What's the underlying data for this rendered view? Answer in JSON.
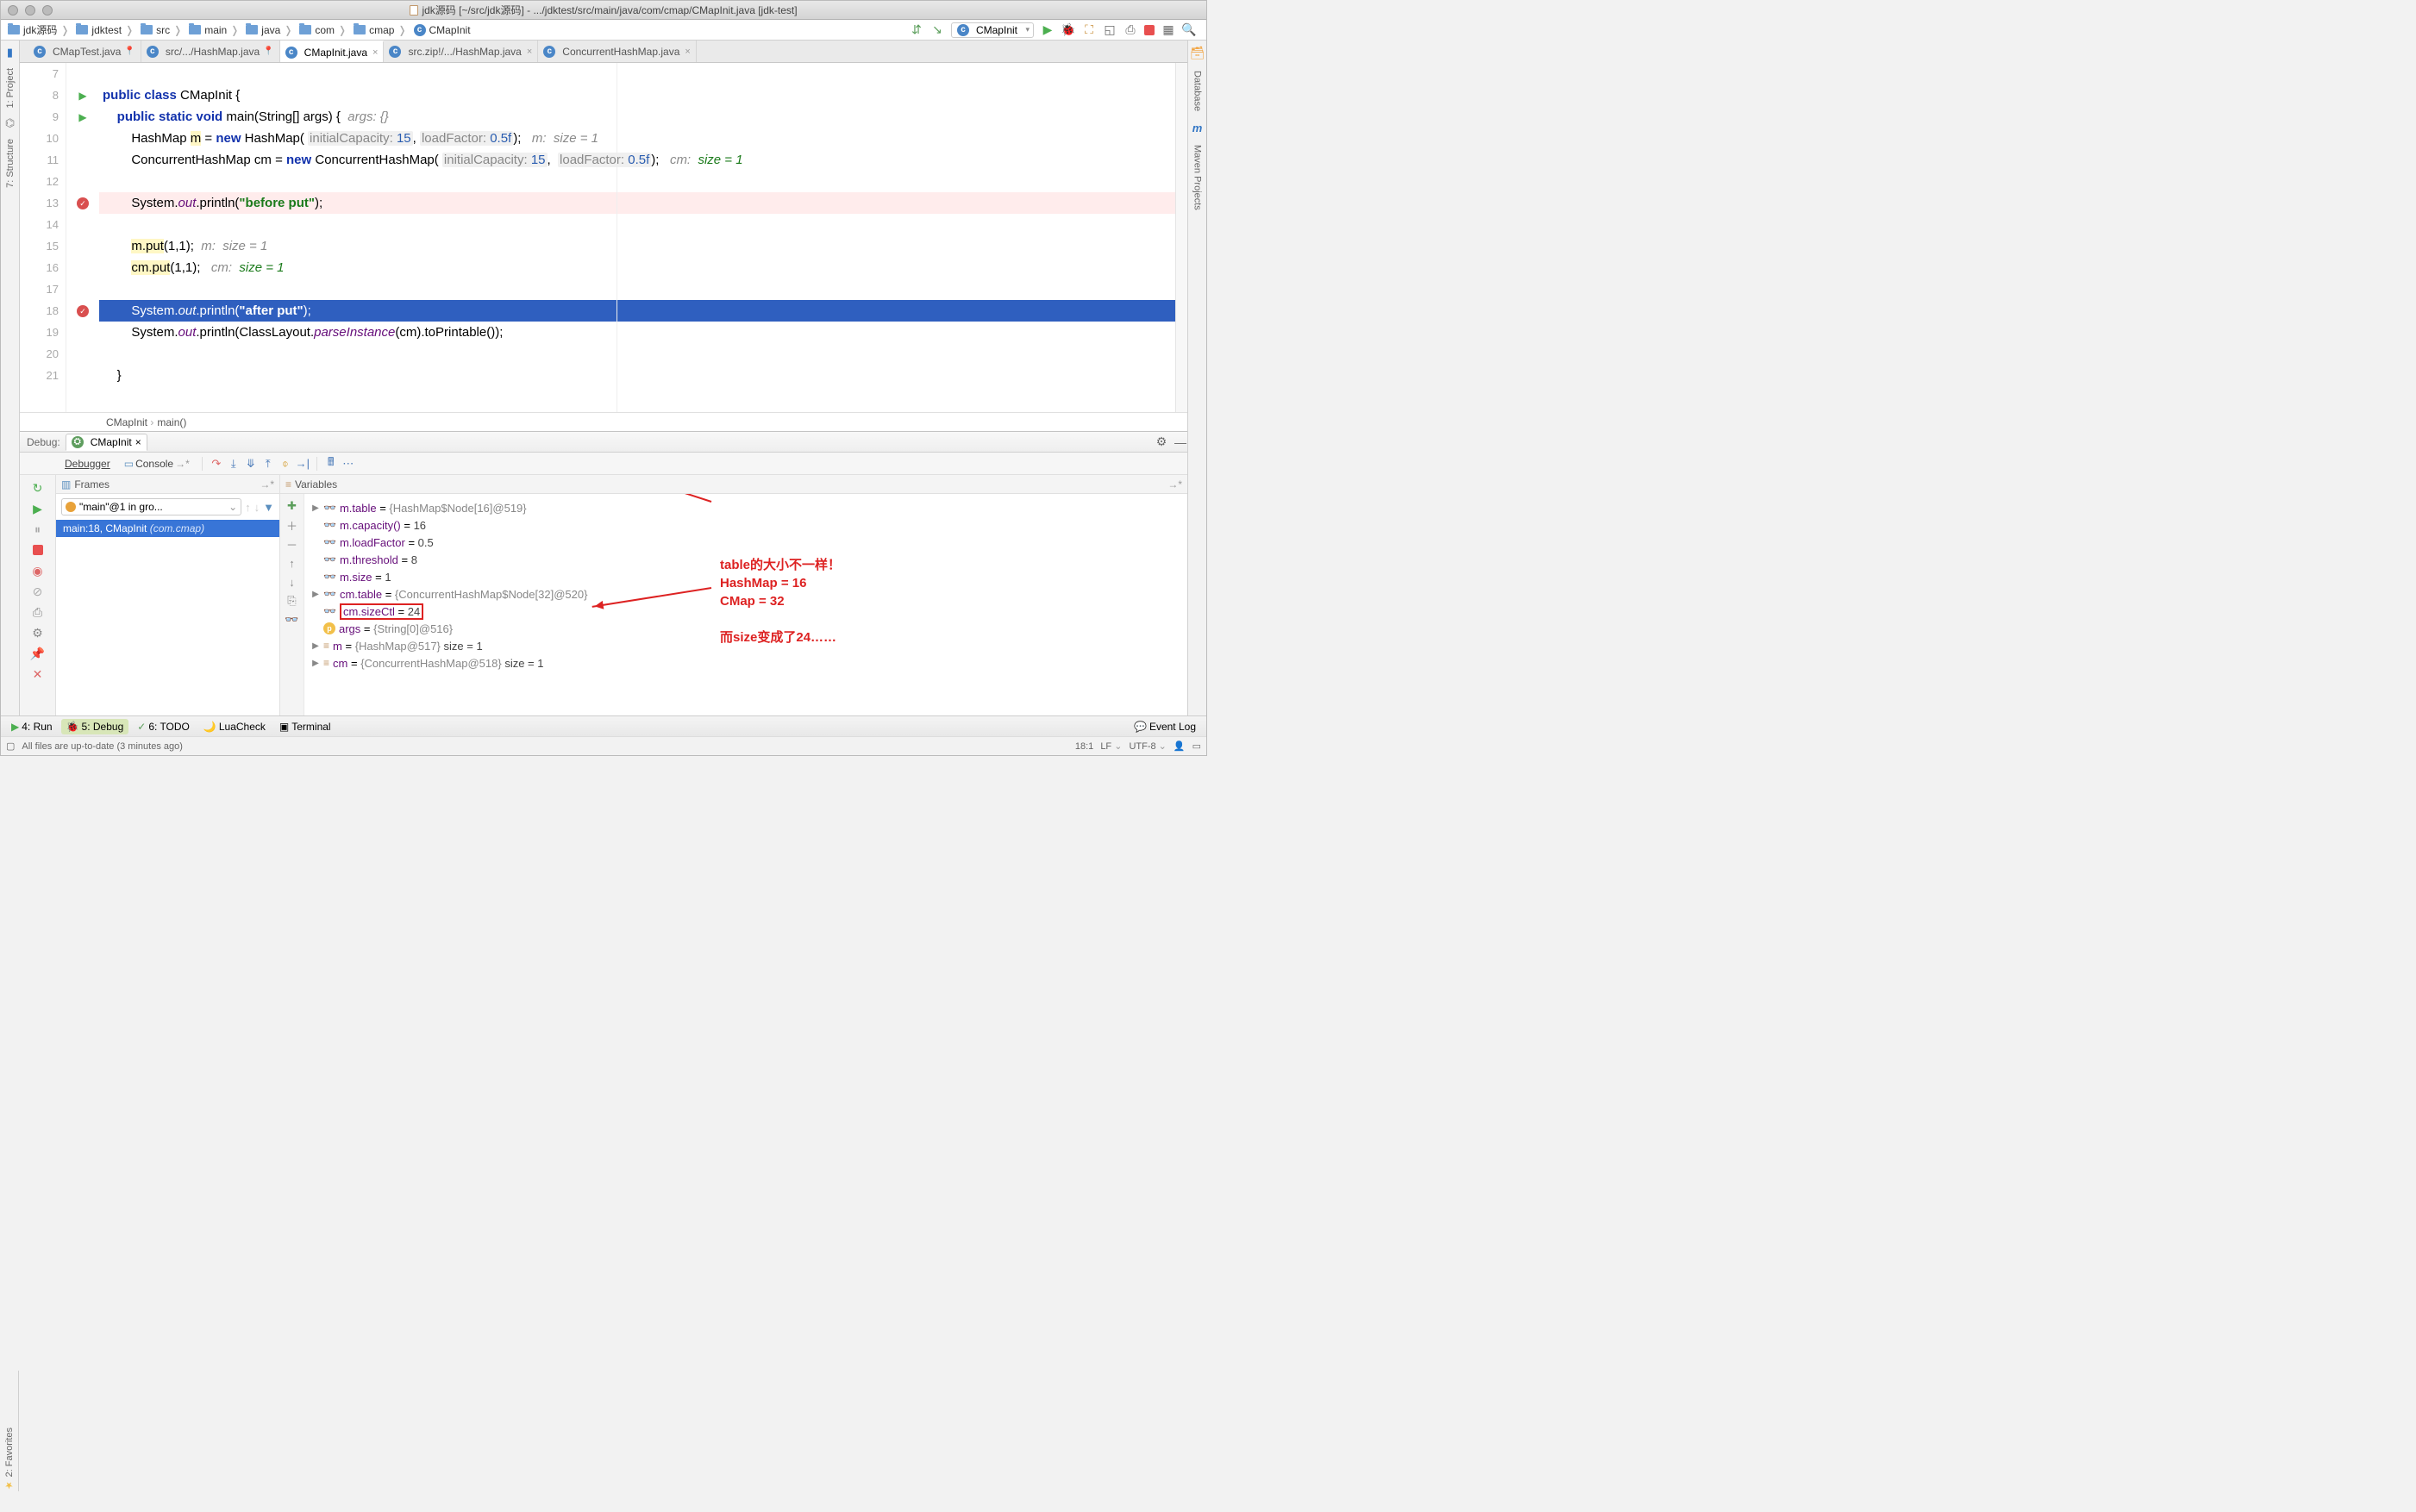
{
  "title": "jdk源码 [~/src/jdk源码] - .../jdktest/src/main/java/com/cmap/CMapInit.java [jdk-test]",
  "breadcrumbs": [
    "jdk源码",
    "jdktest",
    "src",
    "main",
    "java",
    "com",
    "cmap",
    "CMapInit"
  ],
  "run_config": "CMapInit",
  "tabs": [
    {
      "label": "CMapTest.java",
      "active": false,
      "pin": true
    },
    {
      "label": "src/.../HashMap.java",
      "active": false,
      "pin": true
    },
    {
      "label": "CMapInit.java",
      "active": true,
      "close": true
    },
    {
      "label": "src.zip!/.../HashMap.java",
      "active": false,
      "close": true
    },
    {
      "label": "ConcurrentHashMap.java",
      "active": false,
      "close": true
    }
  ],
  "line_start": 7,
  "code_lines": [
    {
      "n": 7,
      "html": ""
    },
    {
      "n": 8,
      "run": true,
      "html": "<span class='kw'>public class</span> CMapInit {"
    },
    {
      "n": 9,
      "run": true,
      "html": "    <span class='kw'>public static void</span> main(String[] args) {  <span class='cmt'>args: {}</span>"
    },
    {
      "n": 10,
      "html": "        HashMap <span class='hl'>m</span> = <span class='kw'>new</span> HashMap( <span class='hint'>initialCapacity: <span class='num'>15</span></span>, <span class='hint'>loadFactor: <span class='num'>0.5f</span></span>);   <span class='cmt'>m:  size = 1</span>"
    },
    {
      "n": 11,
      "html": "        ConcurrentHashMap cm = <span class='kw'>new</span> ConcurrentHashMap( <span class='hint'>initialCapacity: <span class='num'>15</span></span>,  <span class='hint'>loadFactor: <span class='num'>0.5f</span></span>);   <span class='cmt'>cm:  <span class='val'>size = 1</span></span>"
    },
    {
      "n": 12,
      "html": ""
    },
    {
      "n": 13,
      "bp": true,
      "bpline": true,
      "html": "        System.<span class='fld'>out</span>.println(<span class='str'>\"before put\"</span>);"
    },
    {
      "n": 14,
      "html": ""
    },
    {
      "n": 15,
      "html": "        <span class='hl'>m.put</span>(1,1);  <span class='cmt'>m:  size = 1</span>"
    },
    {
      "n": 16,
      "html": "        <span class='hl'>cm.put</span>(1,1);   <span class='cmt'>cm:  <span class='val'>size = 1</span></span>"
    },
    {
      "n": 17,
      "html": ""
    },
    {
      "n": 18,
      "bp": true,
      "cur": true,
      "html": "        System.<span class='fld'>out</span>.println(<span class='str'>\"after put\"</span>);"
    },
    {
      "n": 19,
      "html": "        System.<span class='fld'>out</span>.println(ClassLayout.<span class='fld'>parseInstance</span>(cm).toPrintable());"
    },
    {
      "n": 20,
      "html": ""
    },
    {
      "n": 21,
      "html": "    }"
    }
  ],
  "crumb_bar": [
    "CMapInit",
    "main()"
  ],
  "left_tabs": {
    "project": "1: Project",
    "structure": "7: Structure"
  },
  "right_tabs": {
    "database": "Database",
    "maven": "Maven Projects"
  },
  "fav_tab": "2: Favorites",
  "debug": {
    "label": "Debug:",
    "tab": "CMapInit",
    "tool_tabs": [
      "Debugger",
      "Console"
    ],
    "frames_hdr": "Frames",
    "vars_hdr": "Variables",
    "thread": "\"main\"@1 in gro...",
    "frame": {
      "loc": "main:18, CMapInit",
      "pkg": "(com.cmap)"
    },
    "vars": [
      {
        "exp": "▶",
        "icon": "glasses",
        "text": "<span class='var-name'>m.table</span> = <span class='var-dim'>{HashMap$Node[16]@519}</span>"
      },
      {
        "icon": "glasses",
        "text": "<span class='var-name'>m.capacity()</span> = <span class='var-val'>16</span>"
      },
      {
        "icon": "glasses",
        "text": "<span class='var-name'>m.loadFactor</span> = <span class='var-val'>0.5</span>"
      },
      {
        "icon": "glasses",
        "text": "<span class='var-name'>m.threshold</span> = <span class='var-val'>8</span>"
      },
      {
        "icon": "glasses",
        "text": "<span class='var-name'>m.size</span> = <span class='var-val'>1</span>"
      },
      {
        "exp": "▶",
        "icon": "glasses",
        "text": "<span class='var-name'>cm.table</span> = <span class='var-dim'>{ConcurrentHashMap$Node[32]@520}</span>"
      },
      {
        "icon": "glasses",
        "box": true,
        "text": "<span class='var-name'>cm.sizeCtl</span> = <span class='var-val'>24</span>"
      },
      {
        "icon": "p",
        "text": "<span class='var-name'>args</span> = <span class='var-dim'>{String[0]@516}</span>"
      },
      {
        "exp": "▶",
        "icon": "eq",
        "text": "<span class='var-name'>m</span> = <span class='var-dim'>{HashMap@517}</span>  <span class='var-val'>size = 1</span>"
      },
      {
        "exp": "▶",
        "icon": "eq",
        "text": "<span class='var-name'>cm</span> = <span class='var-dim'>{ConcurrentHashMap@518}</span>  <span class='var-val'>size = 1</span>"
      }
    ],
    "annotation": "table的大小不一样！\nHashMap = 16\nCMap = 32\n\n而size变成了24……"
  },
  "bottom": {
    "run": "4: Run",
    "debug": "5: Debug",
    "todo": "6: TODO",
    "lua": "LuaCheck",
    "term": "Terminal",
    "eventlog": "Event Log"
  },
  "status": {
    "msg": "All files are up-to-date (3 minutes ago)",
    "pos": "18:1",
    "le": "LF",
    "enc": "UTF-8"
  }
}
